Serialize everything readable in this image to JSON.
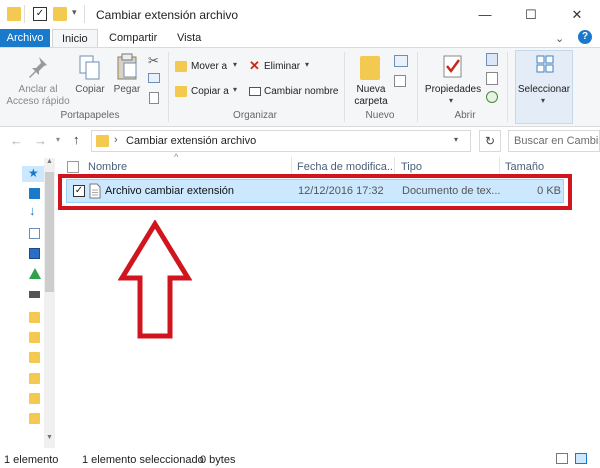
{
  "window": {
    "title": "Cambiar extensión archivo",
    "minimize_glyph": "—",
    "maximize_glyph": "☐",
    "close_glyph": "✕",
    "expand_glyph": "⌄",
    "help_glyph": "?"
  },
  "tabs": [
    "Archivo",
    "Inicio",
    "Compartir",
    "Vista"
  ],
  "ribbon": {
    "portapapeles": {
      "group_label": "Portapapeles",
      "pin_label_1": "Anclar al",
      "pin_label_2": "Acceso rápido",
      "copy_label": "Copiar",
      "paste_label": "Pegar"
    },
    "organizar": {
      "group_label": "Organizar",
      "move_label": "Mover a",
      "copy_to_label": "Copiar a",
      "delete_label": "Eliminar",
      "rename_label": "Cambiar nombre"
    },
    "nuevo": {
      "group_label": "Nuevo",
      "new_folder_1": "Nueva",
      "new_folder_2": "carpeta"
    },
    "abrir": {
      "group_label": "Abrir",
      "properties_label": "Propiedades"
    },
    "seleccionar": {
      "label": "Seleccionar"
    }
  },
  "address": {
    "path": "Cambiar extensión archivo",
    "search_placeholder": "Buscar en Cambiar"
  },
  "columns": {
    "name": "Nombre",
    "date": "Fecha de modifica...",
    "type": "Tipo",
    "size": "Tamaño"
  },
  "files": [
    {
      "name": "Archivo cambiar extensión",
      "date": "12/12/2016 17:32",
      "type": "Documento de tex...",
      "size": "0 KB"
    }
  ],
  "status": {
    "count": "1 elemento",
    "selected": "1 elemento seleccionado",
    "bytes": "0 bytes"
  },
  "colors": {
    "accent": "#1979ca",
    "selection": "#cce8ff",
    "highlight": "#d0151f",
    "folder": "#f3c94f"
  },
  "icons": {
    "pin": "pin-icon",
    "copy": "copy-icon",
    "paste": "paste-icon",
    "cut": "scissors-icon",
    "move": "move-to-icon",
    "delete": "delete-x-icon",
    "rename": "rename-icon",
    "new_folder": "new-folder-icon",
    "properties": "properties-check-icon",
    "select": "select-grid-icon",
    "back": "back-arrow-icon",
    "forward": "forward-arrow-icon",
    "up": "up-arrow-icon",
    "refresh": "refresh-icon",
    "search": "search-icon",
    "annotation_arrow": "red-up-arrow-icon"
  }
}
